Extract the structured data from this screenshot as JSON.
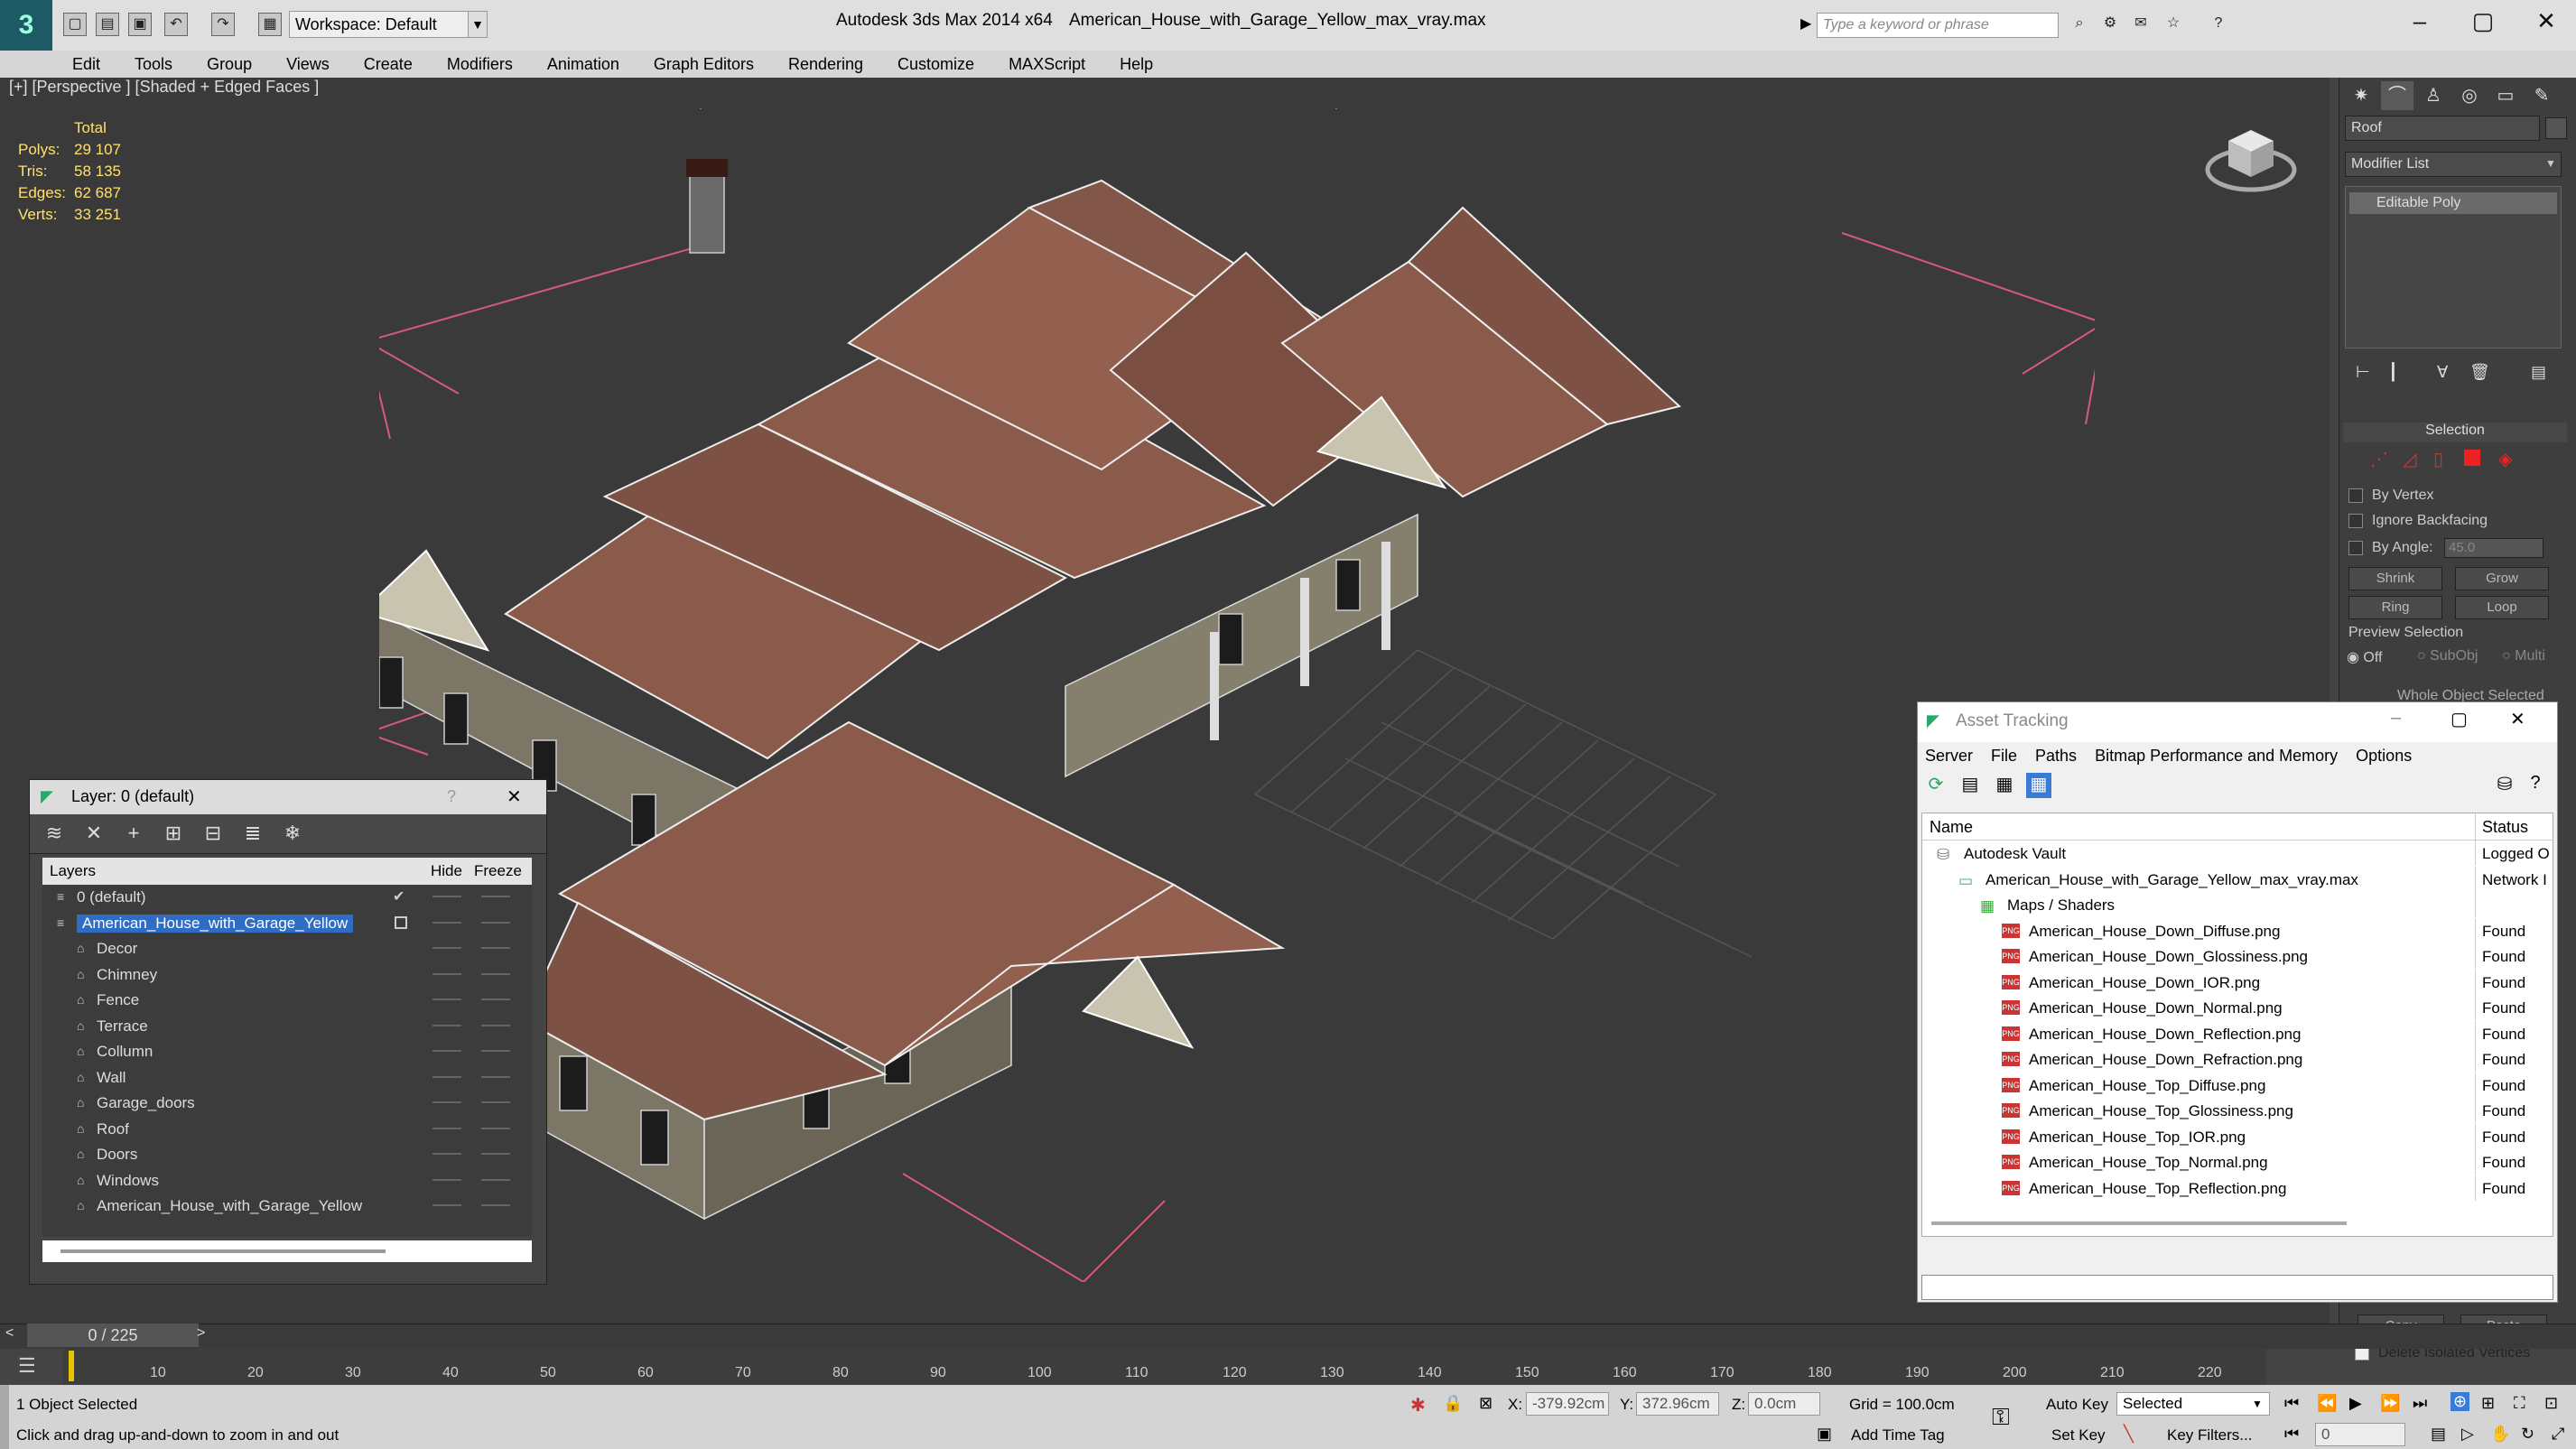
{
  "titlebar": {
    "app": "Autodesk 3ds Max  2014 x64",
    "file": "American_House_with_Garage_Yellow_max_vray.max",
    "workspace": "Workspace: Default",
    "search_placeholder": "Type a keyword or phrase"
  },
  "menu": [
    "Edit",
    "Tools",
    "Group",
    "Views",
    "Create",
    "Modifiers",
    "Animation",
    "Graph Editors",
    "Rendering",
    "Customize",
    "MAXScript",
    "Help"
  ],
  "viewport": {
    "label": "[+] [Perspective ] [Shaded + Edged Faces ]",
    "stats": {
      "total_label": "Total",
      "rows": [
        {
          "label": "Polys:",
          "value": "29 107"
        },
        {
          "label": "Tris:",
          "value": "58 135"
        },
        {
          "label": "Edges:",
          "value": "62 687"
        },
        {
          "label": "Verts:",
          "value": "33 251"
        }
      ]
    }
  },
  "command_panel": {
    "object_name": "Roof",
    "modifier_list": "Modifier List",
    "stack_item": "Editable Poly",
    "selection_title": "Selection",
    "by_vertex": "By Vertex",
    "ignore_backfacing": "Ignore Backfacing",
    "by_angle": "By Angle:",
    "angle_value": "45.0",
    "shrink": "Shrink",
    "grow": "Grow",
    "ring": "Ring",
    "loop": "Loop",
    "preview_selection": "Preview Selection",
    "off": "Off",
    "subobj": "SubObj",
    "multi": "Multi",
    "whole_object": "Whole Object Selected",
    "copy": "Copy",
    "paste": "Paste",
    "delete_isolated": "Delete Isolated Vertices"
  },
  "layer_window": {
    "title": "Layer: 0 (default)",
    "help": "?",
    "col_layers": "Layers",
    "col_hide": "Hide",
    "col_freeze": "Freeze",
    "rows": [
      {
        "name": "0 (default)",
        "indent": 1
      },
      {
        "name": "American_House_with_Garage_Yellow",
        "indent": 1,
        "selected": true
      },
      {
        "name": "Decor",
        "indent": 2
      },
      {
        "name": "Chimney",
        "indent": 2
      },
      {
        "name": "Fence",
        "indent": 2
      },
      {
        "name": "Terrace",
        "indent": 2
      },
      {
        "name": "Collumn",
        "indent": 2
      },
      {
        "name": "Wall",
        "indent": 2
      },
      {
        "name": "Garage_doors",
        "indent": 2
      },
      {
        "name": "Roof",
        "indent": 2
      },
      {
        "name": "Doors",
        "indent": 2
      },
      {
        "name": "Windows",
        "indent": 2
      },
      {
        "name": "American_House_with_Garage_Yellow",
        "indent": 2
      }
    ]
  },
  "asset_window": {
    "title": "Asset Tracking",
    "menu": [
      "Server",
      "File",
      "Paths",
      "Bitmap Performance and Memory",
      "Options"
    ],
    "col_name": "Name",
    "col_status": "Status",
    "rows": [
      {
        "name": "Autodesk Vault",
        "indent": 0,
        "status": "Logged O"
      },
      {
        "name": "American_House_with_Garage_Yellow_max_vray.max",
        "indent": 1,
        "status": "Network I"
      },
      {
        "name": "Maps / Shaders",
        "indent": 2,
        "status": ""
      },
      {
        "name": "American_House_Down_Diffuse.png",
        "indent": 3,
        "status": "Found"
      },
      {
        "name": "American_House_Down_Glossiness.png",
        "indent": 3,
        "status": "Found"
      },
      {
        "name": "American_House_Down_IOR.png",
        "indent": 3,
        "status": "Found"
      },
      {
        "name": "American_House_Down_Normal.png",
        "indent": 3,
        "status": "Found"
      },
      {
        "name": "American_House_Down_Reflection.png",
        "indent": 3,
        "status": "Found"
      },
      {
        "name": "American_House_Down_Refraction.png",
        "indent": 3,
        "status": "Found"
      },
      {
        "name": "American_House_Top_Diffuse.png",
        "indent": 3,
        "status": "Found"
      },
      {
        "name": "American_House_Top_Glossiness.png",
        "indent": 3,
        "status": "Found"
      },
      {
        "name": "American_House_Top_IOR.png",
        "indent": 3,
        "status": "Found"
      },
      {
        "name": "American_House_Top_Normal.png",
        "indent": 3,
        "status": "Found"
      },
      {
        "name": "American_House_Top_Reflection.png",
        "indent": 3,
        "status": "Found"
      }
    ]
  },
  "timeline": {
    "frame": "0 / 225",
    "ticks": [
      "10",
      "20",
      "30",
      "40",
      "50",
      "60",
      "70",
      "80",
      "90",
      "100",
      "110",
      "120",
      "130",
      "140",
      "150",
      "160",
      "170",
      "180",
      "190",
      "200",
      "210",
      "220"
    ]
  },
  "status": {
    "selected": "1 Object Selected",
    "hint": "Click and drag up-and-down to zoom in and out",
    "x_label": "X:",
    "x": "-379.92cm",
    "y_label": "Y:",
    "y": "372.96cm",
    "z_label": "Z:",
    "z": "0.0cm",
    "grid": "Grid = 100.0cm",
    "add_time_tag": "Add Time Tag",
    "auto_key": "Auto Key",
    "set_key": "Set Key",
    "key_mode": "Selected",
    "key_filters": "Key Filters...",
    "frame_value": "0"
  }
}
